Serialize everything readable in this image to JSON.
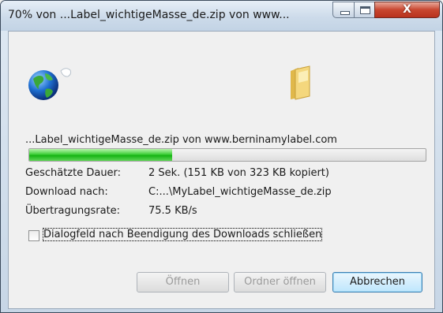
{
  "window": {
    "title": "70% von ...Label_wichtigeMasse_de.zip von www...",
    "close_glyph": "X"
  },
  "icons": {
    "source": "globe-icon",
    "destination": "folder-icon"
  },
  "transfer": {
    "source_line": "...Label_wichtigeMasse_de.zip von www.berninamylabel.com",
    "progress_percent": 36,
    "colors": {
      "progress_fill": "#22b81c",
      "accent_button": "#3c7fb1"
    }
  },
  "details": [
    {
      "label": "Geschätzte Dauer:",
      "value": "2 Sek. (151 KB von 323 KB kopiert)"
    },
    {
      "label": "Download nach:",
      "value": "C:...\\MyLabel_wichtigeMasse_de.zip"
    },
    {
      "label": "Übertragungsrate:",
      "value": "75.5 KB/s"
    }
  ],
  "options": {
    "close_on_complete_label": "Dialogfeld nach Beendigung des Downloads schließen",
    "close_on_complete_checked": false
  },
  "buttons": {
    "open": "Öffnen",
    "open_folder": "Ordner öffnen",
    "cancel": "Abbrechen"
  }
}
